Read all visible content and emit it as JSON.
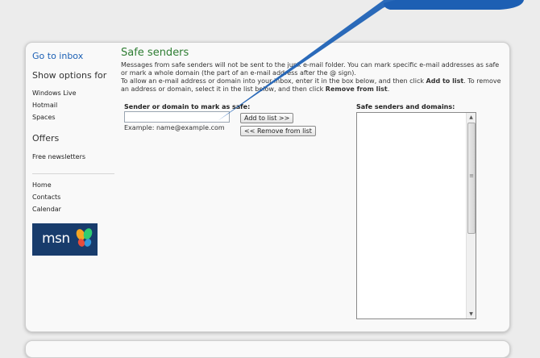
{
  "sidebar": {
    "go_inbox": "Go to inbox",
    "show_options_heading": "Show options for",
    "options": [
      "Windows Live",
      "Hotmail",
      "Spaces"
    ],
    "offers_heading": "Offers",
    "offers": [
      "Free newsletters"
    ],
    "links": [
      "Home",
      "Contacts",
      "Calendar"
    ],
    "logo_text": "msn"
  },
  "main": {
    "title": "Safe senders",
    "desc_1": "Messages from safe senders will not be sent to the junk e-mail folder. You can mark specific e-mail addresses as safe or mark a whole domain (the part of an e-mail address after the @ sign).",
    "desc_2_a": "To allow an e-mail address or domain into your inbox, enter it in the box below, and then click ",
    "desc_2_add": "Add to list",
    "desc_2_b": ". To remove an address or domain, select it in the list below, and then click ",
    "desc_2_remove": "Remove from list",
    "desc_2_c": ".",
    "input_label": "Sender or domain to mark as safe:",
    "input_value": "",
    "example": "Example: name@example.com",
    "add_button": "Add to list >>",
    "remove_button": "<< Remove from list",
    "list_label": "Safe senders and domains:",
    "list_items": []
  },
  "colors": {
    "title_green": "#2e7d32",
    "link_blue": "#1a5fb4",
    "pointer_blue": "#1d5fb3",
    "logo_bg": "#183c6c"
  },
  "icons": {
    "scroll_up": "arrow-up-icon",
    "scroll_down": "arrow-down-icon",
    "logo_butterfly": "msn-butterfly-icon",
    "pointer": "callout-pointer-arrow"
  }
}
